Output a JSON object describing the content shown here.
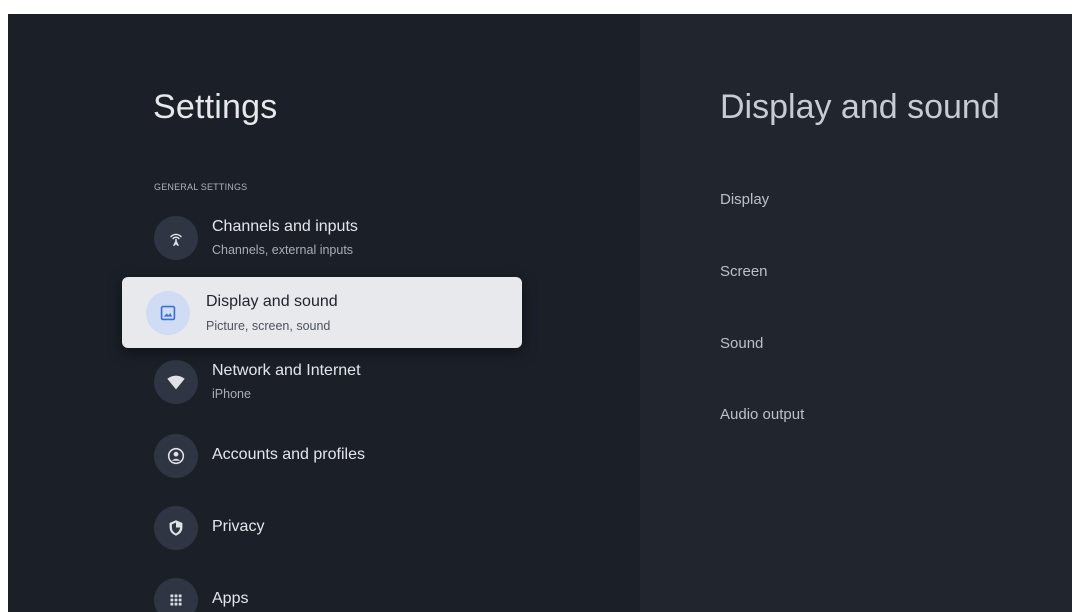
{
  "settings": {
    "title": "Settings",
    "section_label": "GENERAL SETTINGS",
    "items": [
      {
        "label": "Channels and inputs",
        "subtitle": "Channels, external inputs",
        "icon": "antenna-icon"
      },
      {
        "label": "Display and sound",
        "subtitle": "Picture, screen, sound",
        "icon": "image-icon",
        "focused": true
      },
      {
        "label": "Network and Internet",
        "subtitle": "iPhone",
        "icon": "wifi-icon"
      },
      {
        "label": "Accounts and profiles",
        "icon": "account-circle-icon"
      },
      {
        "label": "Privacy",
        "icon": "shield-icon"
      },
      {
        "label": "Apps",
        "icon": "apps-grid-icon"
      }
    ]
  },
  "detail": {
    "title": "Display and sound",
    "items": [
      {
        "label": "Display"
      },
      {
        "label": "Screen"
      },
      {
        "label": "Sound"
      },
      {
        "label": "Audio output"
      }
    ]
  },
  "colors": {
    "background": "#1b2028",
    "detail_background": "#20252e",
    "focus_card": "#e7e9ed",
    "focus_icon_bg": "#cfdcf3",
    "accent": "#3b6fd6"
  }
}
